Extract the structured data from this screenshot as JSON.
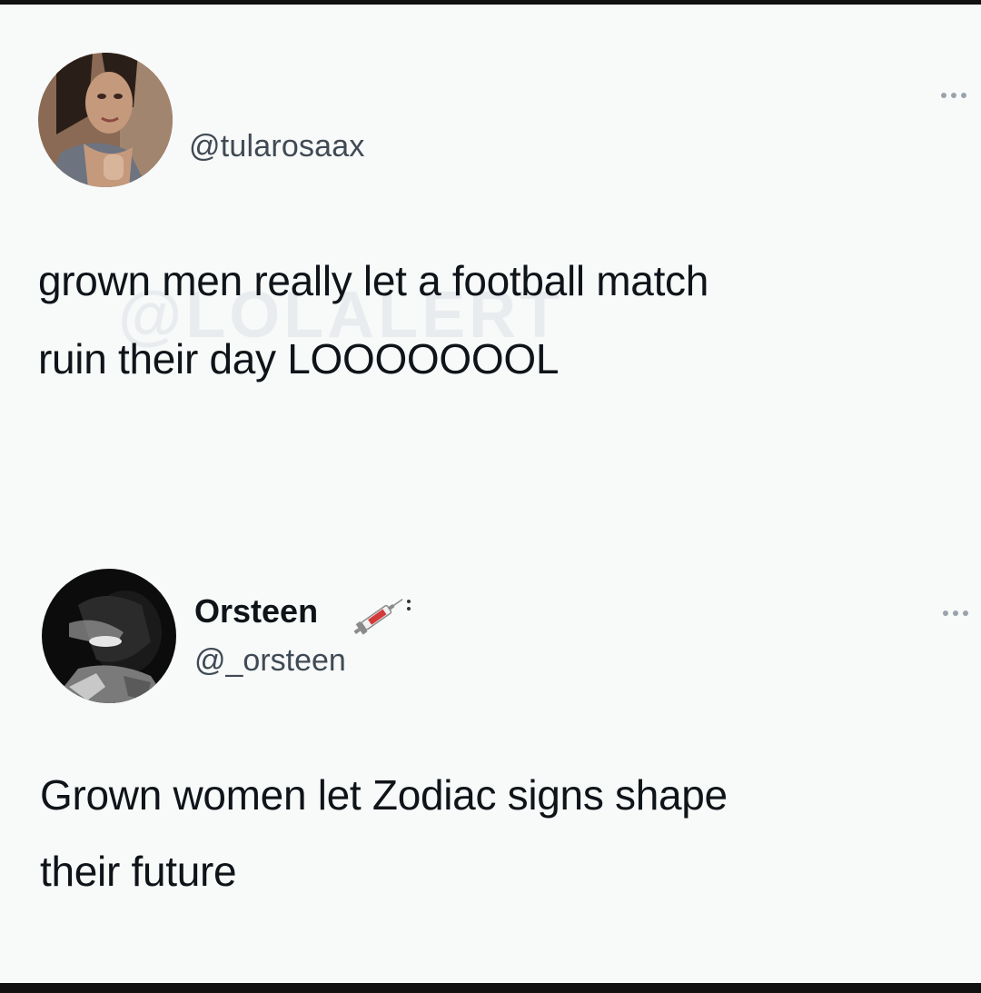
{
  "tweet1": {
    "handle": "@tularosaax",
    "text_lines": [
      "grown men really let a football match",
      "ruin their day LOOOOOOOL"
    ],
    "watermark": "@LOLALERT"
  },
  "tweet2": {
    "name": "Orsteen",
    "handle": "@_orsteen",
    "badge_icon": "syringe-icon",
    "text_lines": [
      "Grown women let Zodiac signs shape",
      "their future"
    ]
  },
  "icons": {
    "more": "more-options-icon"
  },
  "colors": {
    "background": "#f8f9f9",
    "text": "#0f1419",
    "secondary_text": "#3f4a54",
    "dots": "#9aa3ab"
  }
}
